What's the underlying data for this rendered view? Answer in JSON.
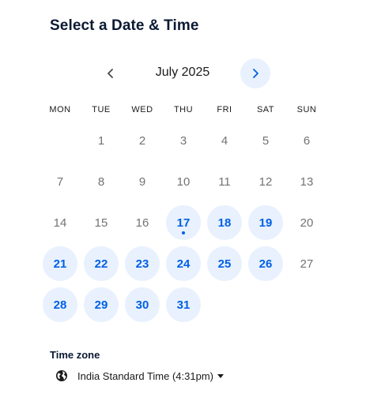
{
  "header": {
    "title": "Select a Date & Time"
  },
  "calendar": {
    "month_label": "July 2025",
    "weekdays": [
      "MON",
      "TUE",
      "WED",
      "THU",
      "FRI",
      "SAT",
      "SUN"
    ],
    "weeks": [
      [
        null,
        {
          "d": "1",
          "a": false
        },
        {
          "d": "2",
          "a": false
        },
        {
          "d": "3",
          "a": false
        },
        {
          "d": "4",
          "a": false
        },
        {
          "d": "5",
          "a": false
        },
        {
          "d": "6",
          "a": false
        }
      ],
      [
        {
          "d": "7",
          "a": false
        },
        {
          "d": "8",
          "a": false
        },
        {
          "d": "9",
          "a": false
        },
        {
          "d": "10",
          "a": false
        },
        {
          "d": "11",
          "a": false
        },
        {
          "d": "12",
          "a": false
        },
        {
          "d": "13",
          "a": false
        }
      ],
      [
        {
          "d": "14",
          "a": false
        },
        {
          "d": "15",
          "a": false
        },
        {
          "d": "16",
          "a": false
        },
        {
          "d": "17",
          "a": true,
          "today": true
        },
        {
          "d": "18",
          "a": true
        },
        {
          "d": "19",
          "a": true
        },
        {
          "d": "20",
          "a": false
        }
      ],
      [
        {
          "d": "21",
          "a": true
        },
        {
          "d": "22",
          "a": true
        },
        {
          "d": "23",
          "a": true
        },
        {
          "d": "24",
          "a": true
        },
        {
          "d": "25",
          "a": true
        },
        {
          "d": "26",
          "a": true
        },
        {
          "d": "27",
          "a": false
        }
      ],
      [
        {
          "d": "28",
          "a": true
        },
        {
          "d": "29",
          "a": true
        },
        {
          "d": "30",
          "a": true
        },
        {
          "d": "31",
          "a": true
        },
        null,
        null,
        null
      ]
    ]
  },
  "timezone": {
    "label": "Time zone",
    "value": "India Standard Time (4:31pm)"
  },
  "colors": {
    "accent": "#0060e6",
    "available_bg": "#e8f1fd",
    "unavailable_text": "#737373"
  },
  "icons": {
    "prev": "chevron-left-icon",
    "next": "chevron-right-icon",
    "timezone": "globe-icon",
    "dropdown": "caret-down-icon"
  }
}
